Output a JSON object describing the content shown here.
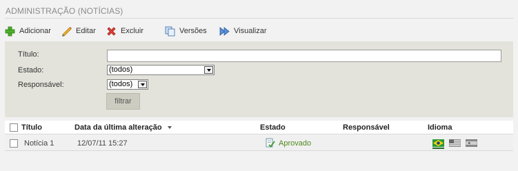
{
  "page": {
    "title": "ADMINISTRAÇÃO (NOTÍCIAS)"
  },
  "toolbar": {
    "add": {
      "label": "Adicionar",
      "icon": "plus-icon"
    },
    "edit": {
      "label": "Editar",
      "icon": "pencil-icon"
    },
    "delete": {
      "label": "Excluir",
      "icon": "delete-x-icon"
    },
    "versions": {
      "label": "Versões",
      "icon": "versions-icon"
    },
    "preview": {
      "label": "Visualizar",
      "icon": "preview-arrows-icon"
    }
  },
  "filters": {
    "title_label": "Título:",
    "title_value": "",
    "state_label": "Estado:",
    "state_value": "(todos)",
    "responsible_label": "Responsável:",
    "responsible_value": "(todos)",
    "button_label": "filtrar"
  },
  "table": {
    "columns": [
      "Título",
      "Data da última alteração",
      "Estado",
      "Responsável",
      "Idioma"
    ],
    "sorted_column": "Data da última alteração",
    "rows": [
      {
        "title": "Notícia 1",
        "date": "12/07/11 15:27",
        "state": "Aprovado",
        "responsible": "",
        "languages": [
          "flag-brazil-icon",
          "flag-usa-icon",
          "flag-spain-icon"
        ],
        "active_language": "flag-brazil-icon"
      }
    ]
  },
  "colors": {
    "background": "#f2f2f2",
    "filter_panel": "#e3e3db",
    "approved_text": "#4f8a1f",
    "title_text": "#8a8a8a"
  }
}
